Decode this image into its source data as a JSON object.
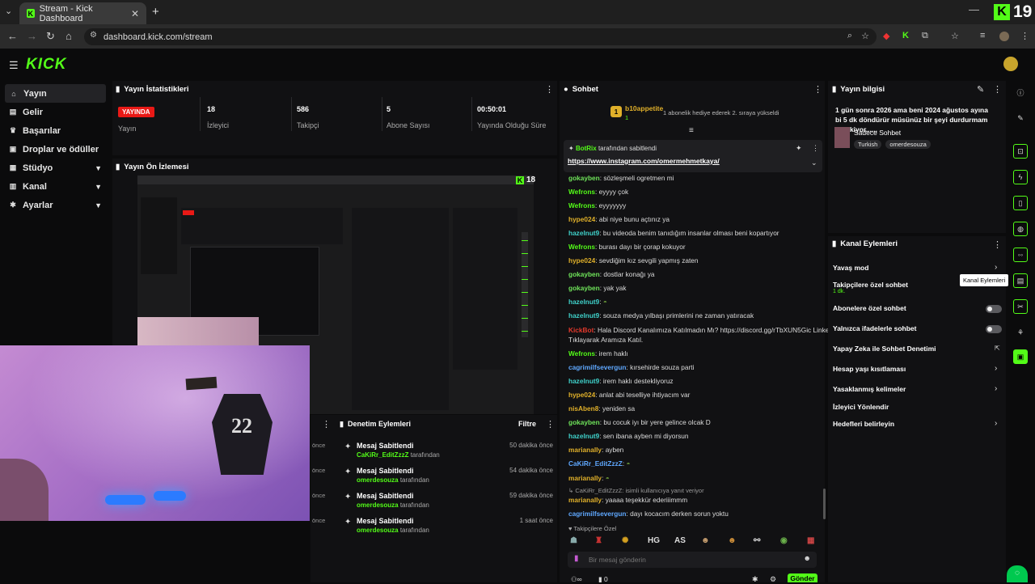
{
  "browser": {
    "tab_title": "Stream - Kick Dashboard",
    "url": "dashboard.kick.com/stream",
    "badge": "19"
  },
  "app": {
    "logo": "KICK"
  },
  "sidebar": {
    "items": [
      {
        "label": "Yayın",
        "icon": "home-icon"
      },
      {
        "label": "Gelir",
        "icon": "income-icon"
      },
      {
        "label": "Başarılar",
        "icon": "trophy-icon"
      },
      {
        "label": "Droplar ve ödüller",
        "icon": "gift-icon"
      },
      {
        "label": "Stüdyo",
        "icon": "studio-icon"
      },
      {
        "label": "Kanal",
        "icon": "channel-icon"
      },
      {
        "label": "Ayarlar",
        "icon": "gear-icon"
      }
    ]
  },
  "stats": {
    "title": "Yayın İstatistikleri",
    "live_badge": "YAYINDA",
    "items": [
      {
        "value": "",
        "label": "Yayın"
      },
      {
        "value": "18",
        "label": "İzleyici"
      },
      {
        "value": "586",
        "label": "Takipçi"
      },
      {
        "value": "5",
        "label": "Abone Sayısı"
      },
      {
        "value": "00:50:01",
        "label": "Yayında Olduğu Süre"
      }
    ]
  },
  "preview": {
    "title": "Yayın Ön İzlemesi",
    "viewer_count": "18"
  },
  "mod": {
    "title": "Denetim Eylemleri",
    "filter": "Filtre",
    "suffix": "tarafından",
    "prev_times": [
      "önce",
      "önce",
      "önce",
      "önce"
    ],
    "rows": [
      {
        "title": "Mesaj Sabitlendi",
        "user": "CaKiRr_EditZzzZ",
        "time": "50 dakika önce"
      },
      {
        "title": "Mesaj Sabitlendi",
        "user": "omerdesouza",
        "time": "54 dakika önce"
      },
      {
        "title": "Mesaj Sabitlendi",
        "user": "omerdesouza",
        "time": "59 dakika önce"
      },
      {
        "title": "Mesaj Sabitlendi",
        "user": "omerdesouza",
        "time": "1 saat önce"
      }
    ]
  },
  "chat": {
    "title": "Sohbet",
    "gift": {
      "user": "b10appetite",
      "count": "1",
      "text": "1 abonelik hediye ederek 2. sıraya yükseldi"
    },
    "pinned": {
      "by": "BotRix",
      "text": "tarafından sabitlendi",
      "link": "https://www.instagram.com/omermehmetkaya/"
    },
    "messages": [
      {
        "user": "gokayben",
        "color": "#6fe35a",
        "text": "sözleşmeli ogretmen mi"
      },
      {
        "user": "Wefrons",
        "color": "#53fc18",
        "text": "eyyyy çok"
      },
      {
        "user": "Wefrons",
        "color": "#53fc18",
        "text": "eyyyyyyy"
      },
      {
        "user": "hype024",
        "color": "#e0b02a",
        "text": "abi niye bunu açtınız ya"
      },
      {
        "user": "hazelnut9",
        "color": "#3fd0c9",
        "text": "bu videoda benim tanıdığım insanlar olması beni kopartıyor"
      },
      {
        "user": "Wefrons",
        "color": "#53fc18",
        "text": "burası dayı bir çorap kokuyor"
      },
      {
        "user": "hype024",
        "color": "#e0b02a",
        "text": "sevdiğim kız sevgili yapmış zaten"
      },
      {
        "user": "gokayben",
        "color": "#6fe35a",
        "text": "dostlar konağı ya"
      },
      {
        "user": "gokayben",
        "color": "#6fe35a",
        "text": "yak yak"
      },
      {
        "user": "hazelnut9",
        "color": "#3fd0c9",
        "text": ""
      },
      {
        "user": "hazelnut9",
        "color": "#3fd0c9",
        "text": "souza medya yılbaşı primlerini ne zaman yatıracak"
      },
      {
        "user": "KickBot",
        "color": "#e2382c",
        "text": "Hala Discord Kanalımıza Katılmadın Mı? https://discord.gg/rTbXUN5Gic Linke"
      },
      {
        "user": "",
        "color": "#ddd",
        "text": "Tıklayarak Aramıza Katıl."
      },
      {
        "user": "Wefrons",
        "color": "#53fc18",
        "text": "irem haklı"
      },
      {
        "user": "cagrimilfsevergun",
        "color": "#5fa8ff",
        "text": "kırsehirde souza parti"
      },
      {
        "user": "hazelnut9",
        "color": "#3fd0c9",
        "text": "irem haklı destekliyoruz"
      },
      {
        "user": "hype024",
        "color": "#e0b02a",
        "text": "anlat abi teselliye ihtiyacım var"
      },
      {
        "user": "nisAben8",
        "color": "#e0b02a",
        "text": "yeniden sa"
      },
      {
        "user": "gokayben",
        "color": "#6fe35a",
        "text": "bu cocuk iyı bir yere gelince olcak D"
      },
      {
        "user": "hazelnut9",
        "color": "#3fd0c9",
        "text": "sen ibana ayben mi diyorsun"
      },
      {
        "user": "marianally",
        "color": "#e0b02a",
        "text": "ayben"
      },
      {
        "user": "CaKiRr_EditZzzZ",
        "color": "#5fa8ff",
        "text": ""
      },
      {
        "user": "marianally",
        "color": "#e0b02a",
        "text": ""
      },
      {
        "user": "",
        "color": "#999",
        "text": "↳ CaKiRr_EditZzzZ: isimli kullanıcıya yanıt veriyor"
      },
      {
        "user": "marianally",
        "color": "#e0b02a",
        "text": "yaaaa teşekkür ederiiimmm"
      },
      {
        "user": "cagrimilfsevergun",
        "color": "#5fa8ff",
        "text": "dayı kocacım derken sorun yoktu"
      }
    ],
    "followers_only": "Takipçilere Özel",
    "emotes": [
      "HG",
      "AS"
    ],
    "placeholder": "Bir mesaj gönderin",
    "send": "Gönder",
    "count": "0"
  },
  "info": {
    "title": "Yayın bilgisi",
    "stream_title": "1 gün sonra 2026 ama beni 2024 ağustos ayına bi 5 dk döndürür müsünüz bir şeyi durdurmam gerekiyor......",
    "category": "Sadece Sohbet",
    "tags": [
      "Turkish",
      "omerdesouza"
    ]
  },
  "actions": {
    "title": "Kanal Eylemleri",
    "tooltip": "Kanal Eylemleri",
    "items": [
      {
        "label": "Yavaş mod",
        "sub": "",
        "control": "arrow"
      },
      {
        "label": "Takipçilere özel sohbet",
        "sub": "1 dk.",
        "control": "arrow"
      },
      {
        "label": "Abonelere özel sohbet",
        "sub": "",
        "control": "toggle"
      },
      {
        "label": "Yalnızca ifadelerle sohbet",
        "sub": "",
        "control": "toggle"
      },
      {
        "label": "Yapay Zeka ile Sohbet Denetimi",
        "sub": "",
        "control": "external"
      },
      {
        "label": "Hesap yaşı kısıtlaması",
        "sub": "",
        "control": "arrow"
      },
      {
        "label": "Yasaklanmış kelimeler",
        "sub": "",
        "control": "arrow"
      },
      {
        "label": "İzleyici Yönlendir",
        "sub": "",
        "control": "none"
      },
      {
        "label": "Hedefleri belirleyin",
        "sub": "",
        "control": "arrow"
      }
    ]
  },
  "colors": {
    "accent": "#53fc18",
    "live": "#e91916",
    "bg": "#0b0b0c",
    "panel": "#111113"
  }
}
